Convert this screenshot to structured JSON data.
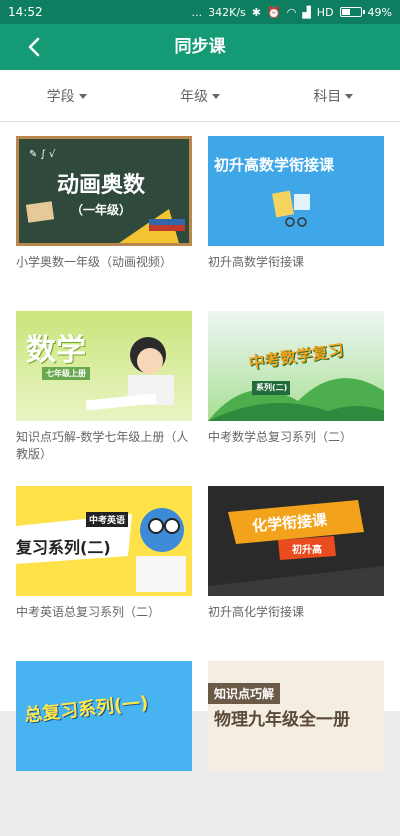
{
  "status_bar": {
    "time": "14:52",
    "dots": "...",
    "network_speed": "342K/s",
    "network_type": "HD",
    "battery": "49%",
    "battery_level": 0.49
  },
  "header": {
    "title": "同步课",
    "back_icon": "chevron-left-icon"
  },
  "filters": [
    {
      "label": "学段"
    },
    {
      "label": "年级"
    },
    {
      "label": "科目"
    }
  ],
  "courses": [
    {
      "title": "小学奥数一年级（动画视频）",
      "thumb_title": "动画奥数",
      "thumb_sub": "（一年级）"
    },
    {
      "title": "初升高数学衔接课",
      "thumb_title": "初升高数学衔接课",
      "thumb_sub": ""
    },
    {
      "title": "知识点巧解-数学七年级上册（人教版）",
      "thumb_title": "数学",
      "thumb_sub": "七年级上册"
    },
    {
      "title": "中考数学总复习系列（二）",
      "thumb_title": "中考数学复习",
      "thumb_sub": "系列(二)"
    },
    {
      "title": "中考英语总复习系列（二）",
      "thumb_title": "复习系列(二)",
      "thumb_sub": "中考英语"
    },
    {
      "title": "初升高化学衔接课",
      "thumb_title": "化学衔接课",
      "thumb_sub": "初升高"
    },
    {
      "title": "",
      "thumb_title": "总复习系列(一)",
      "thumb_sub": ""
    },
    {
      "title": "",
      "thumb_title": "物理九年级全一册",
      "thumb_sub": "知识点巧解"
    }
  ]
}
